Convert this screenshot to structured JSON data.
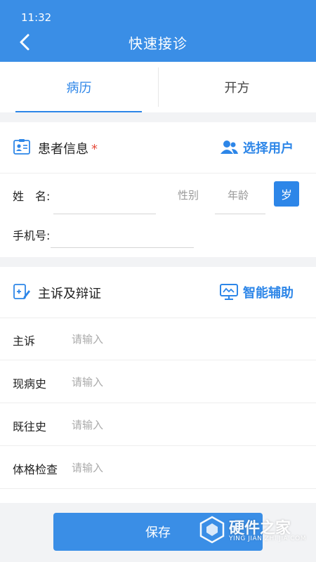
{
  "status_bar": {
    "time": "11:32"
  },
  "header": {
    "title": "快速接诊",
    "back_icon": "back-icon"
  },
  "tabs": [
    {
      "label": "病历",
      "active": true
    },
    {
      "label": "开方",
      "active": false
    }
  ],
  "patient_section": {
    "title": "患者信息",
    "required_mark": "*",
    "action_label": "选择用户",
    "name_label": "姓　名:",
    "gender_placeholder": "性别",
    "age_placeholder": "年龄",
    "age_unit": "岁",
    "phone_label": "手机号:"
  },
  "complaint_section": {
    "title": "主诉及辩证",
    "action_label": "智能辅助",
    "rows": [
      {
        "label": "主诉",
        "placeholder": "请输入"
      },
      {
        "label": "现病史",
        "placeholder": "请输入"
      },
      {
        "label": "既往史",
        "placeholder": "请输入"
      },
      {
        "label": "体格检查",
        "placeholder": "请输入"
      }
    ]
  },
  "save_label": "保存",
  "watermark": {
    "title": "硬件之家",
    "subtitle": "YING JIAN ZHI JIA.COM"
  },
  "colors": {
    "primary": "#3a8ee6",
    "accent": "#2d86e8",
    "required": "#e74c3c"
  }
}
